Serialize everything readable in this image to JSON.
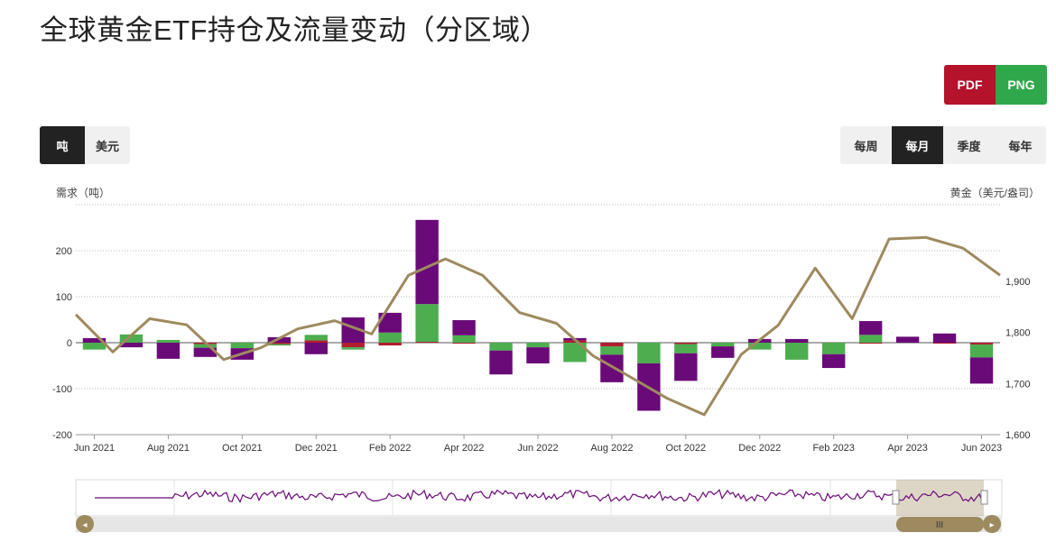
{
  "title": "全球黄金ETF持仓及流量变动（分区域）",
  "export": {
    "pdf": "PDF",
    "png": "PNG"
  },
  "unit_toggle": {
    "items": [
      "吨",
      "美元"
    ],
    "active": 0
  },
  "period_toggle": {
    "items": [
      "每周",
      "每月",
      "季度",
      "每年"
    ],
    "active": 1
  },
  "colors": {
    "purple": "#6a0a78",
    "green": "#4cae4f",
    "red": "#b01e2f",
    "gold_line": "#9e8a5f",
    "nav_line": "#6a0a78"
  },
  "navigator": {
    "left_handle_glyph": "◂",
    "right_handle_glyph": "▸",
    "thumb_glyph": "III"
  },
  "chart_data": {
    "type": "bar",
    "ylabel_left": "需求（吨）",
    "ylabel_right": "黄金（美元/盎司）",
    "ylim_left": [
      -200,
      300
    ],
    "ylim_right": [
      1600,
      2050
    ],
    "yticks_left": [
      -200,
      -100,
      0,
      100,
      200
    ],
    "yticks_right": [
      "1,600",
      "1,700",
      "1,800",
      "1,900"
    ],
    "yticks_right_values": [
      1600,
      1700,
      1800,
      1900
    ],
    "x_tick_labels": [
      "Jun 2021",
      "Aug 2021",
      "Oct 2021",
      "Dec 2021",
      "Feb 2022",
      "Apr 2022",
      "Jun 2022",
      "Aug 2022",
      "Oct 2022",
      "Dec 2022",
      "Feb 2023",
      "Apr 2023",
      "Jun 2023"
    ],
    "months": [
      "2021-06",
      "2021-07",
      "2021-08",
      "2021-09",
      "2021-10",
      "2021-11",
      "2021-12",
      "2022-01",
      "2022-02",
      "2022-03",
      "2022-04",
      "2022-05",
      "2022-06",
      "2022-07",
      "2022-08",
      "2022-09",
      "2022-10",
      "2022-11",
      "2022-12",
      "2023-01",
      "2023-02",
      "2023-03",
      "2023-04",
      "2023-05",
      "2023-06"
    ],
    "series": [
      {
        "values": [
          10,
          -10,
          -35,
          -20,
          -25,
          12,
          -25,
          55,
          43,
          183,
          33,
          -52,
          -35,
          5,
          -60,
          -103,
          -60,
          -25,
          8,
          8,
          -30,
          30,
          13,
          20,
          -57
        ]
      },
      {
        "values": [
          -15,
          18,
          6,
          -8,
          -12,
          -3,
          12,
          -5,
          22,
          82,
          16,
          -17,
          -10,
          -42,
          -18,
          -45,
          -20,
          -8,
          -15,
          -37,
          -25,
          17,
          0,
          0,
          -28
        ]
      },
      {
        "values": [
          0,
          0,
          0,
          -3,
          0,
          -3,
          5,
          -10,
          -6,
          2,
          -2,
          0,
          0,
          5,
          -8,
          0,
          -3,
          0,
          0,
          0,
          0,
          -2,
          0,
          -2,
          -4
        ]
      }
    ],
    "gold_price": [
      1835,
      1762,
      1827,
      1815,
      1747,
      1770,
      1807,
      1823,
      1797,
      1912,
      1944,
      1912,
      1839,
      1818,
      1754,
      1713,
      1671,
      1639,
      1757,
      1814,
      1926,
      1827,
      1983,
      1986,
      1965,
      1912
    ]
  }
}
